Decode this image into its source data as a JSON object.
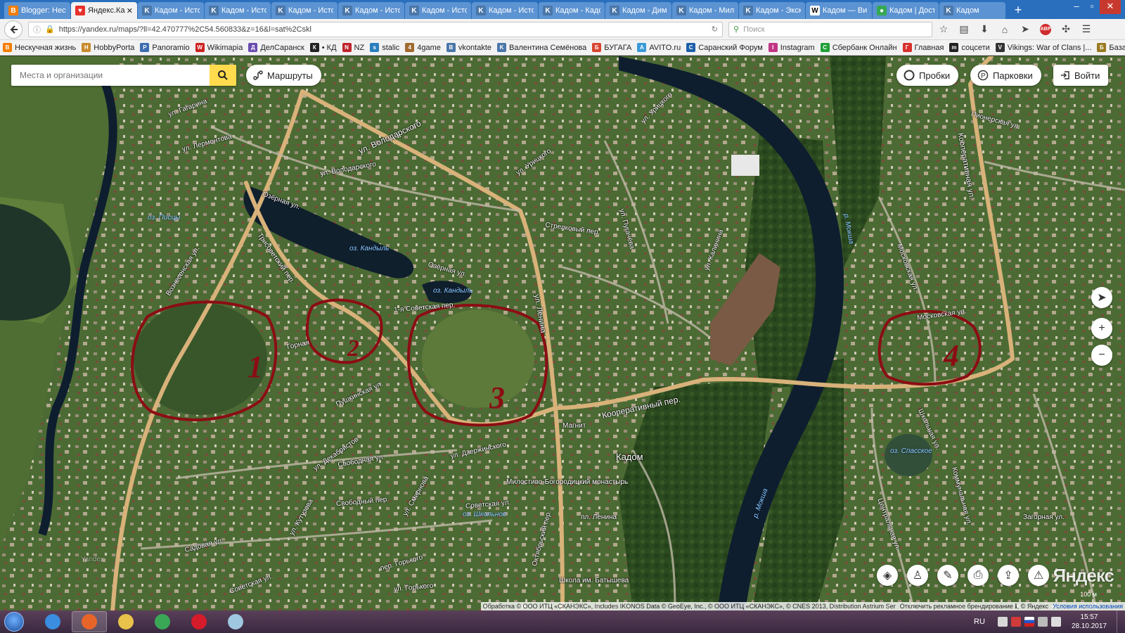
{
  "browser": {
    "tabs": [
      {
        "label": "Blogger: Неск",
        "icon": "blogger-icon",
        "color": "#f57d00",
        "glyph": "B"
      },
      {
        "label": "Яндекс.Кар",
        "icon": "yandex-maps-icon",
        "color": "#e8312a",
        "glyph": "♥",
        "active": true,
        "close": "✕"
      },
      {
        "label": "Кадом - Исто",
        "icon": "vk-icon",
        "color": "#4a76a8",
        "glyph": "K"
      },
      {
        "label": "Кадом - Исто",
        "icon": "vk-icon",
        "color": "#4a76a8",
        "glyph": "K"
      },
      {
        "label": "Кадом - Исто",
        "icon": "vk-icon",
        "color": "#4a76a8",
        "glyph": "K"
      },
      {
        "label": "Кадом - Исто",
        "icon": "vk-icon",
        "color": "#4a76a8",
        "glyph": "K"
      },
      {
        "label": "Кадом - Исто",
        "icon": "vk-icon",
        "color": "#4a76a8",
        "glyph": "K"
      },
      {
        "label": "Кадом - Исто",
        "icon": "vk-icon",
        "color": "#4a76a8",
        "glyph": "K"
      },
      {
        "label": "Кадом - Кадо",
        "icon": "vk-icon",
        "color": "#4a76a8",
        "glyph": "K"
      },
      {
        "label": "Кадом - Дима",
        "icon": "vk-icon",
        "color": "#4a76a8",
        "glyph": "K"
      },
      {
        "label": "Кадом - Мил",
        "icon": "vk-icon",
        "color": "#4a76a8",
        "glyph": "K"
      },
      {
        "label": "Кадом - Экск",
        "icon": "vk-icon",
        "color": "#4a76a8",
        "glyph": "K"
      },
      {
        "label": "Кадом — Ви",
        "icon": "wikipedia-icon",
        "color": "#ffffff",
        "glyph": "W"
      },
      {
        "label": "Кадом | Дост",
        "icon": "tripadvisor-icon",
        "color": "#34a853",
        "glyph": "●"
      },
      {
        "label": "Кадом",
        "icon": "vk-icon",
        "color": "#4a76a8",
        "glyph": "K"
      }
    ],
    "new_tab": "+",
    "window_controls": {
      "minimize": "–",
      "maximize": "▫",
      "close": "✕"
    },
    "url": "https://yandex.ru/maps/?ll=42.470777%2C54.560833&z=16&l=sat%2Cskl",
    "search_placeholder": "Поиск",
    "bookmarks": [
      {
        "label": "Нескучная жизнь",
        "color": "#f57d00",
        "glyph": "B"
      },
      {
        "label": "HobbyPorta",
        "color": "#c98a2a",
        "glyph": "H"
      },
      {
        "label": "Panoramio",
        "color": "#3c6db0",
        "glyph": "P"
      },
      {
        "label": "Wikimapia",
        "color": "#cc2222",
        "glyph": "W"
      },
      {
        "label": "ДелСаранск",
        "color": "#6a4cb0",
        "glyph": "Д"
      },
      {
        "label": "• КД",
        "color": "#222222",
        "glyph": "К"
      },
      {
        "label": "NZ",
        "color": "#c0242d",
        "glyph": "N"
      },
      {
        "label": "stalic",
        "color": "#2a7fbd",
        "glyph": "s"
      },
      {
        "label": "4game",
        "color": "#a06a30",
        "glyph": "4"
      },
      {
        "label": "vkontakte",
        "color": "#4a76a8",
        "glyph": "B"
      },
      {
        "label": "Валентина Семёнова",
        "color": "#4a76a8",
        "glyph": "K"
      },
      {
        "label": "БУГАГА",
        "color": "#d9442f",
        "glyph": "Б"
      },
      {
        "label": "AVITO.ru",
        "color": "#3a9ad9",
        "glyph": "A"
      },
      {
        "label": "Саранский Форум",
        "color": "#1e5fa8",
        "glyph": "С"
      },
      {
        "label": "Instagram",
        "color": "#c13584",
        "glyph": "I"
      },
      {
        "label": "Сбербанк Онлайн",
        "color": "#21a038",
        "glyph": "С"
      },
      {
        "label": "Главная",
        "color": "#d9302c",
        "glyph": "Г"
      },
      {
        "label": "соцсети",
        "color": "#222222",
        "glyph": "m"
      },
      {
        "label": "Vikings: War of Clans |...",
        "color": "#333333",
        "glyph": "V"
      },
      {
        "label": "База знаний по игре ...",
        "color": "#9a7a20",
        "glyph": "Б"
      }
    ]
  },
  "map": {
    "search_placeholder": "Места и организации",
    "routes_label": "Маршруты",
    "traffic_label": "Пробки",
    "parking_label": "Парковки",
    "login_label": "Войти",
    "city_label": "Кадом",
    "logo": "Яндекс",
    "scale": "100 м",
    "watermark": "Yandex",
    "streets": [
      "ул. Гагарина",
      "ул. Лермонтова",
      "ул. Володарского",
      "ул. Володарского",
      "Вознесенская ул.",
      "Трисоветский пер.",
      "Озёрная ул.",
      "Озёрная ул.",
      "ул. Урицкого",
      "ул. Урицкого",
      "ул. Ленина",
      "Стрелковый пер.",
      "Кооперативный пер.",
      "Кооперативная ул.",
      "Московская ул.",
      "Пионерская ул.",
      "ул. Декабристов",
      "ул. Дзержинского",
      "Пушкинская ул.",
      "Свободная ул.",
      "Свободный пер.",
      "Советская ул.",
      "ул. Смирнова",
      "пл. Ленина",
      "Октябрьский пер.",
      "Садовая ул.",
      "Школьная ул.",
      "Коммунальная ул.",
      "Загорная ул.",
      "Горная",
      "Центральная ул.",
      "пер. Горького",
      "ул. Горького",
      "ул. Кутузова",
      "Советская ул.",
      "Милостиво-Богородицкий монастырь",
      "Школа им. Батышева",
      "Магнит",
      "1-я Советская пер.",
      "ул. Пугачёва",
      "ул. Калинина",
      "Московская ул."
    ],
    "water": [
      "оз. Писцы",
      "оз. Кандыль",
      "оз. Кандыль",
      "р. Мокша",
      "р. Мокша",
      "оз. Спасское",
      "оз. Школьное"
    ],
    "annotations": [
      "1",
      "2",
      "3",
      "4"
    ],
    "annotation_color": "#8b0d14",
    "copyright": "Обработка © ООО ИТЦ «СКАНЭКС», Includes IKONOS Data © GeoEye, Inc., © ООО ИТЦ «СКАНЭКС», © CNES 2013, Distribution Astrium Ser",
    "copyright_tail": "Отключить рекламное брендирование ℹ, © Яндекс",
    "terms_link": "Условия использования"
  },
  "taskbar": {
    "language": "RU",
    "time": "15:57",
    "date": "28.10.2017",
    "apps": [
      {
        "name": "internet-explorer-icon",
        "color": "#3a8de0"
      },
      {
        "name": "firefox-icon",
        "color": "#e8652a",
        "active": true
      },
      {
        "name": "file-explorer-icon",
        "color": "#e8c24a"
      },
      {
        "name": "chrome-icon",
        "color": "#3aa757"
      },
      {
        "name": "opera-icon",
        "color": "#d41c2a"
      },
      {
        "name": "notepad-icon",
        "color": "#9fc7e0"
      }
    ]
  }
}
